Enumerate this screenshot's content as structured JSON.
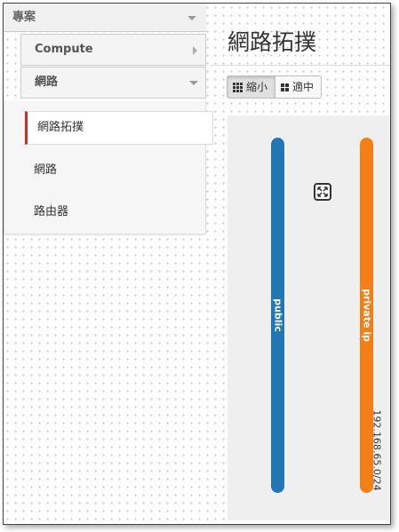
{
  "sidebar": {
    "project_header": "專案",
    "compute_header": "Compute",
    "network_header": "網路",
    "items": [
      {
        "label": "網路拓撲",
        "active": true
      },
      {
        "label": "網路",
        "active": false
      },
      {
        "label": "路由器",
        "active": false
      }
    ]
  },
  "main": {
    "title": "網路拓撲",
    "toolbar": {
      "small_label": "縮小",
      "normal_label": "適中",
      "active": "small"
    }
  },
  "topology": {
    "networks": [
      {
        "name": "public",
        "color": "#2176b3"
      },
      {
        "name": "private ip",
        "color": "#f57f17",
        "cidr": "192.168.65.0/24"
      }
    ],
    "icon": "collapse-arrows-icon"
  }
}
